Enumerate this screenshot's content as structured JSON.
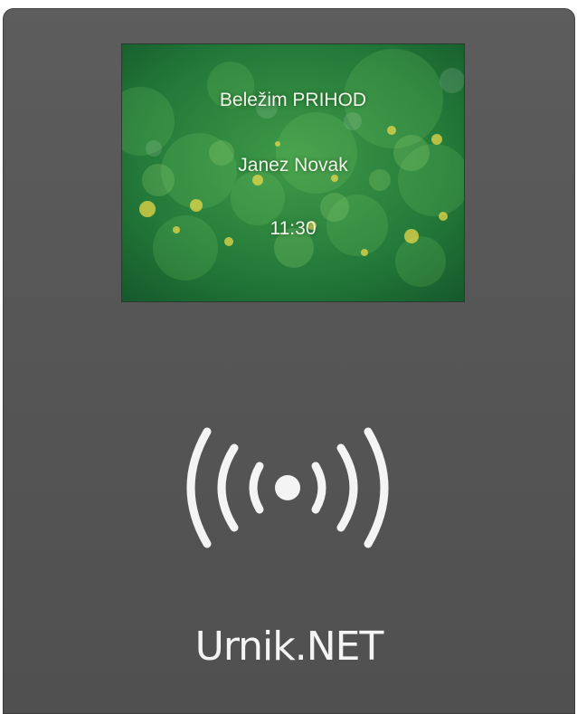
{
  "screen": {
    "status": "Beležim PRIHOD",
    "name": "Janez Novak",
    "time": "11:30"
  },
  "reader": {
    "icon": "nfc-contactless-icon"
  },
  "brand": {
    "name": "Urnik.NET"
  },
  "colors": {
    "device_body": "#585858",
    "screen_green": "#1f6e37",
    "screen_text": "#f2f5ea",
    "brand_text": "#f4f4f4"
  }
}
